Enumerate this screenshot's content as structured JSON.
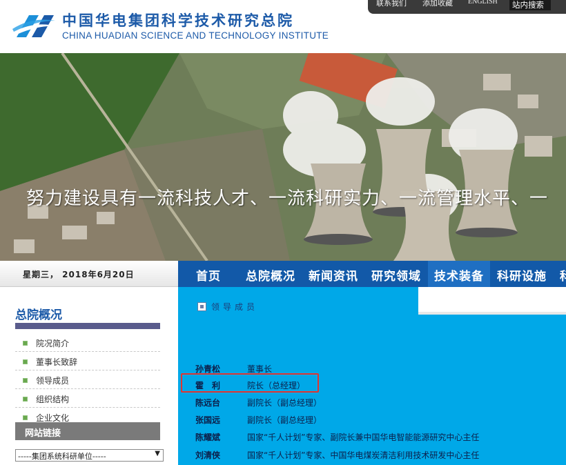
{
  "header": {
    "title_cn": "中国华电集团科学技术研究总院",
    "title_en": "CHINA HUADIAN SCIENCE AND TECHNOLOGY INSTITUTE",
    "toplinks": [
      "联系我们",
      "添加收藏",
      "ENGLISH"
    ],
    "site_search": "站内搜索"
  },
  "banner": {
    "slogan": "努力建设具有一流科技人才、一流科研实力、一流管理水平、一"
  },
  "datebar": {
    "date": "星期三， 2018年6月20日"
  },
  "nav": {
    "items": [
      "首页",
      "总院概况",
      "新闻资讯",
      "研究领域",
      "技术装备",
      "科研设施",
      "科"
    ],
    "active_index": 4
  },
  "sidebar": {
    "title": "总院概况",
    "items": [
      "院况简介",
      "董事长致辞",
      "领导成员",
      "组织结构",
      "企业文化"
    ],
    "links_title": "网站链接",
    "select_value": "-----集团系统科研单位-----"
  },
  "main": {
    "section_title": "领导成员",
    "members": [
      {
        "name": "孙青松",
        "title": "董事长"
      },
      {
        "name": "霍　利",
        "title": "院长（总经理）"
      },
      {
        "name": "陈远台",
        "title": "副院长（副总经理）"
      },
      {
        "name": "张国远",
        "title": "副院长（副总经理）"
      },
      {
        "name": "陈耀斌",
        "title": "国家“千人计划”专家、副院长兼中国华电智能能源研究中心主任"
      },
      {
        "name": "刘清侠",
        "title": "国家“千人计划”专家、中国华电煤炭清洁利用技术研发中心主任"
      }
    ],
    "highlighted_index": 1
  },
  "colors": {
    "brand_blue": "#1c5aa8",
    "nav_blue": "#1259a8",
    "content_cyan": "#00a8e8",
    "highlight_red": "#e3342f"
  }
}
